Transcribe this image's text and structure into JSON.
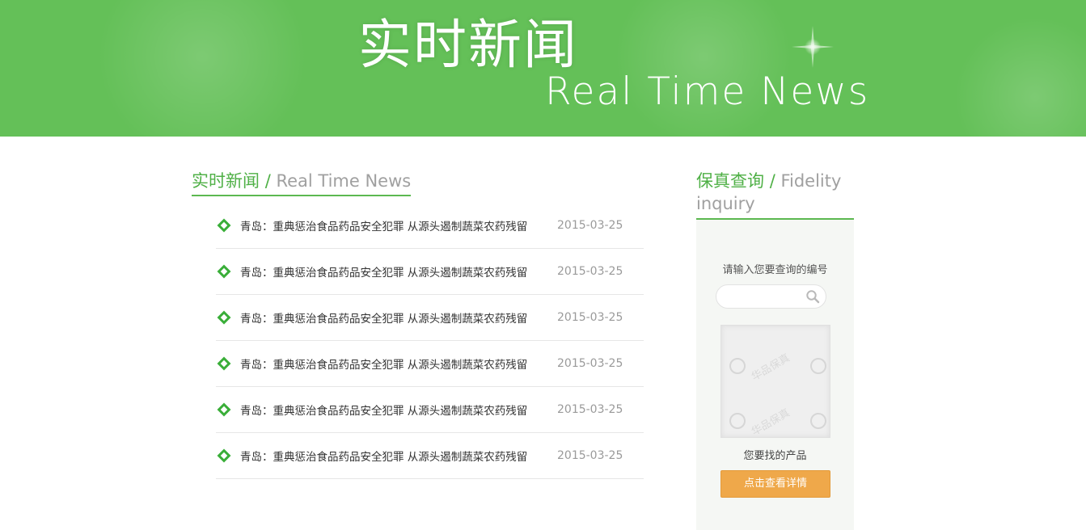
{
  "banner": {
    "title_cn": "实时新闻",
    "title_en": "Real Time News",
    "background_color": "#64c058"
  },
  "news": {
    "heading_cn": "实时新闻",
    "heading_separator": "/",
    "heading_en": "Real Time News",
    "items": [
      {
        "title": "青岛：重典惩治食品药品安全犯罪 从源头遏制蔬菜农药残留",
        "date": "2015-03-25"
      },
      {
        "title": "青岛：重典惩治食品药品安全犯罪 从源头遏制蔬菜农药残留",
        "date": "2015-03-25"
      },
      {
        "title": "青岛：重典惩治食品药品安全犯罪 从源头遏制蔬菜农药残留",
        "date": "2015-03-25"
      },
      {
        "title": "青岛：重典惩治食品药品安全犯罪 从源头遏制蔬菜农药残留",
        "date": "2015-03-25"
      },
      {
        "title": "青岛：重典惩治食品药品安全犯罪 从源头遏制蔬菜农药残留",
        "date": "2015-03-25"
      },
      {
        "title": "青岛：重典惩治食品药品安全犯罪 从源头遏制蔬菜农药残留",
        "date": "2015-03-25"
      }
    ],
    "bullet_icon": "diamond-icon",
    "accent_color": "#3aae39"
  },
  "sidebar": {
    "heading_cn": "保真查询",
    "heading_separator": "/",
    "heading_en": "Fidelity inquiry",
    "prompt": "请输入您要查询的编号",
    "search_value": "",
    "search_icon": "search-icon",
    "seal_watermark": "华品保真",
    "product_label": "您要找的产品",
    "detail_button": "点击查看详情",
    "button_color": "#efa84a"
  }
}
